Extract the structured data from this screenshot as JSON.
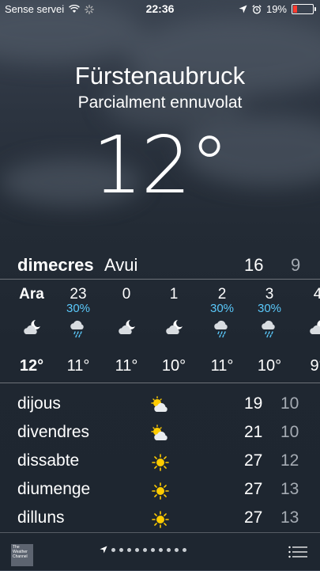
{
  "status_bar": {
    "carrier": "Sense servei",
    "time": "22:36",
    "battery": "19%",
    "battery_level": 0.19
  },
  "location": {
    "city": "Fürstenaubruck",
    "condition": "Parcialment ennuvolat",
    "temperature": "12°"
  },
  "today": {
    "day": "dimecres",
    "label": "Avui",
    "high": "16",
    "low": "9"
  },
  "hourly": [
    {
      "hour": "Ara",
      "precip": "",
      "icon": "partly-cloudy-night-icon",
      "temp": "12°"
    },
    {
      "hour": "23",
      "precip": "30%",
      "icon": "rain-icon",
      "temp": "11°"
    },
    {
      "hour": "0",
      "precip": "",
      "icon": "partly-cloudy-night-icon",
      "temp": "11°"
    },
    {
      "hour": "1",
      "precip": "",
      "icon": "partly-cloudy-night-icon",
      "temp": "10°"
    },
    {
      "hour": "2",
      "precip": "30%",
      "icon": "rain-icon",
      "temp": "11°"
    },
    {
      "hour": "3",
      "precip": "30%",
      "icon": "rain-icon",
      "temp": "10°"
    },
    {
      "hour": "4",
      "precip": "",
      "icon": "partly-cloudy-night-icon",
      "temp": "9°"
    }
  ],
  "daily": [
    {
      "day": "dijous",
      "icon": "partly-cloudy-day-icon",
      "high": "19",
      "low": "10"
    },
    {
      "day": "divendres",
      "icon": "partly-cloudy-day-icon",
      "high": "21",
      "low": "10"
    },
    {
      "day": "dissabte",
      "icon": "sun-icon",
      "high": "27",
      "low": "12"
    },
    {
      "day": "diumenge",
      "icon": "sun-icon",
      "high": "27",
      "low": "13"
    },
    {
      "day": "dilluns",
      "icon": "sun-icon",
      "high": "27",
      "low": "13"
    }
  ],
  "footer": {
    "logo_text": "The Weather Channel",
    "page_dots": 10
  },
  "colors": {
    "precip": "#5ac8fa",
    "sun": "#ffcc00",
    "low_temp": "#a5abb3",
    "battery_low": "#ff3b30"
  }
}
